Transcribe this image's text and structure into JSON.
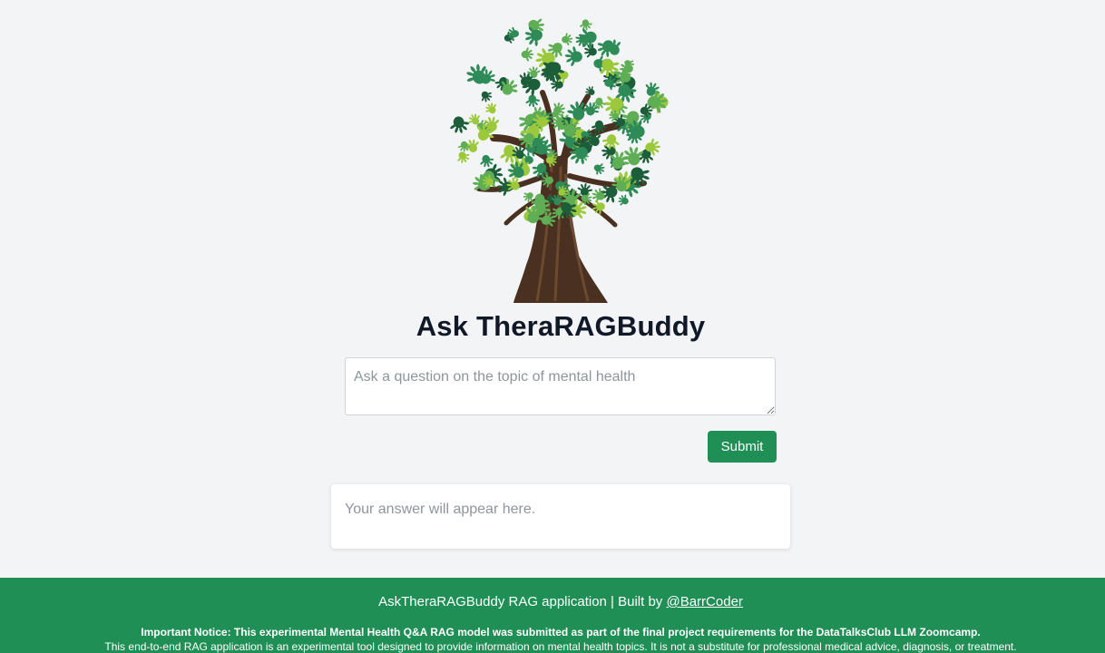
{
  "app": {
    "title": "Ask TheraRAGBuddy"
  },
  "logo": {
    "icon": "hands-tree-icon",
    "colors": [
      "#2e8b57",
      "#5fae56",
      "#9cc93b",
      "#1d5e3a",
      "#4f3421"
    ]
  },
  "form": {
    "question_placeholder": "Ask a question on the topic of mental health",
    "question_value": "",
    "submit_label": "Submit"
  },
  "answer": {
    "placeholder": "Your answer will appear here."
  },
  "footer": {
    "credit_prefix": "AskTheraRAGBuddy RAG application | Built by",
    "author_link": "@BarrCoder",
    "notice_title": "Important Notice: This experimental Mental Health Q&A RAG model was submitted as part of the final project requirements for the DataTalksClub LLM Zoomcamp.",
    "notice_text": "This end-to-end RAG application is an experimental tool designed to provide information on mental health topics. It is not a substitute for professional medical advice, diagnosis, or treatment."
  },
  "colors": {
    "accent": "#1f8f55",
    "background": "#f3f4f6"
  }
}
